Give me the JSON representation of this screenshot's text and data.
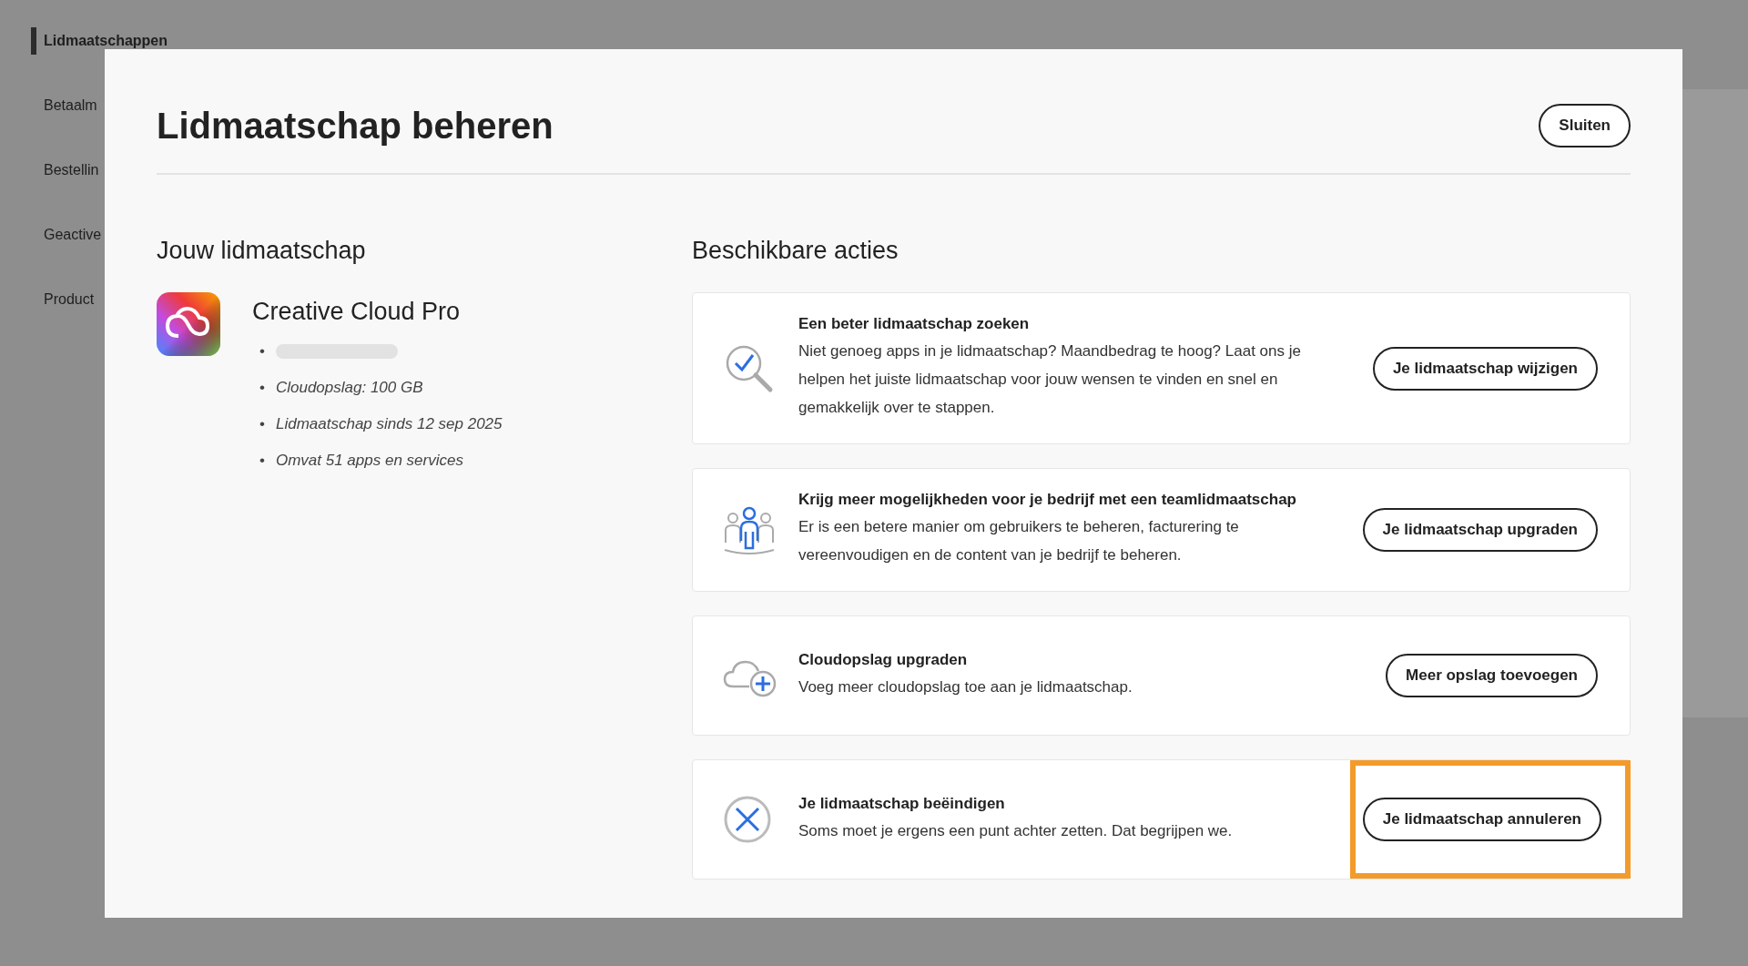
{
  "background_page": {
    "sidebar": {
      "items": [
        {
          "label": "Lidmaatschappen",
          "selected": true
        },
        {
          "label": "Betaalm",
          "selected": false
        },
        {
          "label": "Bestellin",
          "selected": false
        },
        {
          "label": "Geactive",
          "selected": false
        },
        {
          "label": "Product",
          "selected": false
        }
      ]
    }
  },
  "dialog": {
    "title": "Lidmaatschap beheren",
    "close_button": "Sluiten",
    "membership": {
      "heading": "Jouw lidmaatschap",
      "plan_name": "Creative Cloud Pro",
      "details": [
        {
          "kind": "hidden",
          "marker": "•"
        },
        {
          "kind": "text",
          "marker": "•",
          "text": "Cloudopslag: 100 GB"
        },
        {
          "kind": "text",
          "marker": "•",
          "text": "Lidmaatschap sinds 12 sep 2025"
        },
        {
          "kind": "text",
          "marker": "•",
          "text": "Omvat 51 apps en services"
        }
      ]
    },
    "actions_heading": "Beschikbare acties",
    "actions": [
      {
        "title": "Een beter lidmaatschap zoeken",
        "description": "Niet genoeg apps in je lidmaatschap? Maandbedrag te hoog? Laat ons je helpen het juiste lidmaatschap voor jouw wensen te vinden en snel en gemakkelijk over te stappen.",
        "button": "Je lidmaatschap wijzigen",
        "highlighted": false
      },
      {
        "title": "Krijg meer mogelijkheden voor je bedrijf met een teamlidmaatschap",
        "description": "Er is een betere manier om gebruikers te beheren, facturering te vereenvoudigen en de content van je bedrijf te beheren.",
        "button": "Je lidmaatschap upgraden",
        "highlighted": false
      },
      {
        "title": "Cloudopslag upgraden",
        "description": "Voeg meer cloudopslag toe aan je lidmaatschap.",
        "button": "Meer opslag toevoegen",
        "highlighted": false
      },
      {
        "title": "Je lidmaatschap beëindigen",
        "description": "Soms moet je ergens een punt achter zetten. Dat begrijpen we.",
        "button": "Je lidmaatschap annuleren",
        "highlighted": true
      }
    ]
  }
}
